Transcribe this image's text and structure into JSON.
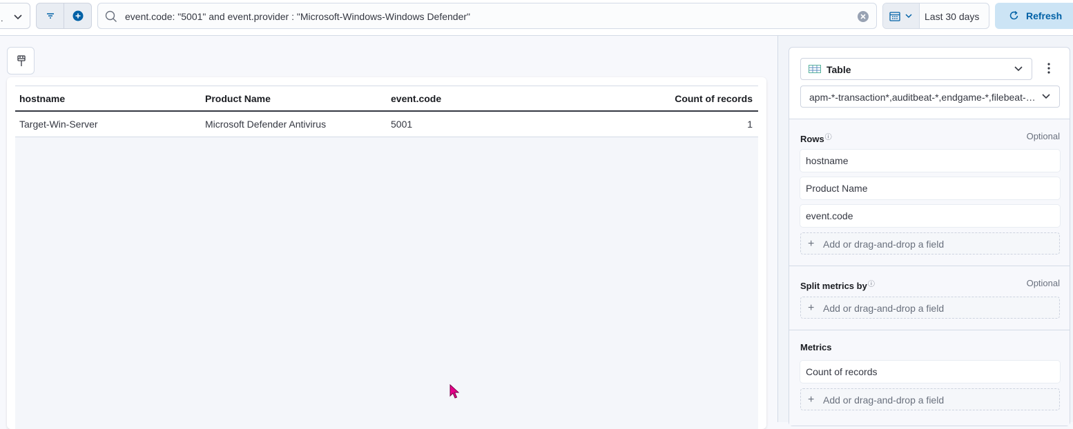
{
  "topbar": {
    "data_view_glyph": ".",
    "query": "event.code: \"5001\" and event.provider : \"Microsoft-Windows-Windows Defender\"",
    "date_range": "Last 30 days",
    "refresh_label": "Refresh"
  },
  "table": {
    "columns": [
      "hostname",
      "Product Name",
      "event.code",
      "Count of records"
    ],
    "rows": [
      [
        "Target-Win-Server",
        "Microsoft Defender Antivirus",
        "5001",
        "1"
      ]
    ]
  },
  "config": {
    "visualization": "Table",
    "data_view": "apm-*-transaction*,auditbeat-*,endgame-*,filebeat-*,logs-*,packetbeat-*,traces-apm*,winlogbeat-*,-*elastic-cloud-logs-*",
    "rows": {
      "label": "Rows",
      "help": "ⓘ",
      "optional": "Optional",
      "fields": [
        "hostname",
        "Product Name",
        "event.code"
      ],
      "add_label": "Add or drag-and-drop a field"
    },
    "split": {
      "label": "Split metrics by",
      "help": "ⓘ",
      "optional": "Optional",
      "add_label": "Add or drag-and-drop a field"
    },
    "metrics": {
      "label": "Metrics",
      "fields": [
        "Count of records"
      ],
      "add_label": "Add or drag-and-drop a field"
    }
  },
  "colors": {
    "accent": "#0061a6",
    "accent_bg": "#cce4f5",
    "cursor": "#e6008a"
  }
}
